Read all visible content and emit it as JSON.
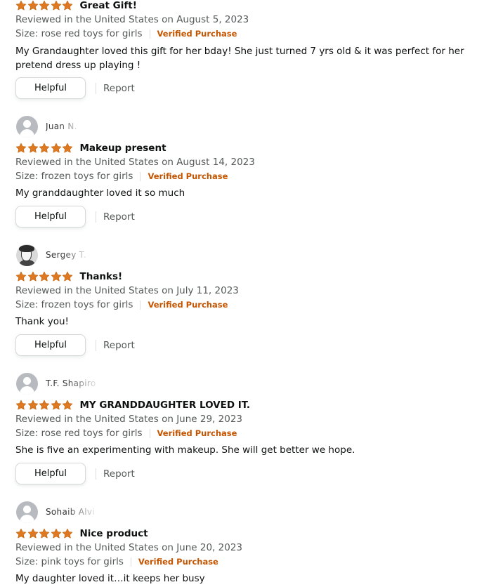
{
  "reviews": [
    {
      "reviewer": "",
      "rating": 5,
      "title": "Great Gift!",
      "reviewed_in": "Reviewed in the United States on August 5, 2023",
      "size": "Size: rose red toys for girls",
      "verified": "Verified Purchase",
      "body": "My Grandaughter loved this gift for her bday! She just turned 7 yrs old & it was perfect for her pretend dress up playing !",
      "helpful_label": "Helpful",
      "report_label": "Report"
    },
    {
      "reviewer": "Juan N.",
      "rating": 5,
      "title": "Makeup present",
      "reviewed_in": "Reviewed in the United States on August 14, 2023",
      "size": "Size: frozen toys for girls",
      "verified": "Verified Purchase",
      "body": "My granddaughter loved it so much",
      "helpful_label": "Helpful",
      "report_label": "Report"
    },
    {
      "reviewer": "Sergey T.",
      "rating": 5,
      "title": "Thanks!",
      "reviewed_in": "Reviewed in the United States on July 11, 2023",
      "size": "Size: frozen toys for girls",
      "verified": "Verified Purchase",
      "body": "Thank you!",
      "helpful_label": "Helpful",
      "report_label": "Report"
    },
    {
      "reviewer": "T.F. Shapiro",
      "rating": 5,
      "title": "MY GRANDDAUGHTER LOVED IT.",
      "reviewed_in": "Reviewed in the United States on June 29, 2023",
      "size": "Size: rose red toys for girls",
      "verified": "Verified Purchase",
      "body": "She is five an experimenting with makeup. She will get better we hope.",
      "helpful_label": "Helpful",
      "report_label": "Report"
    },
    {
      "reviewer": "Sohaib Alvi",
      "rating": 5,
      "title": "Nice product",
      "reviewed_in": "Reviewed in the United States on June 20, 2023",
      "size": "Size: pink toys for girls",
      "verified": "Verified Purchase",
      "body": "My daughter loved it…it keeps her busy"
    }
  ],
  "colors": {
    "star": "#de7921",
    "verified": "#c45500",
    "muted_text": "#565959"
  }
}
